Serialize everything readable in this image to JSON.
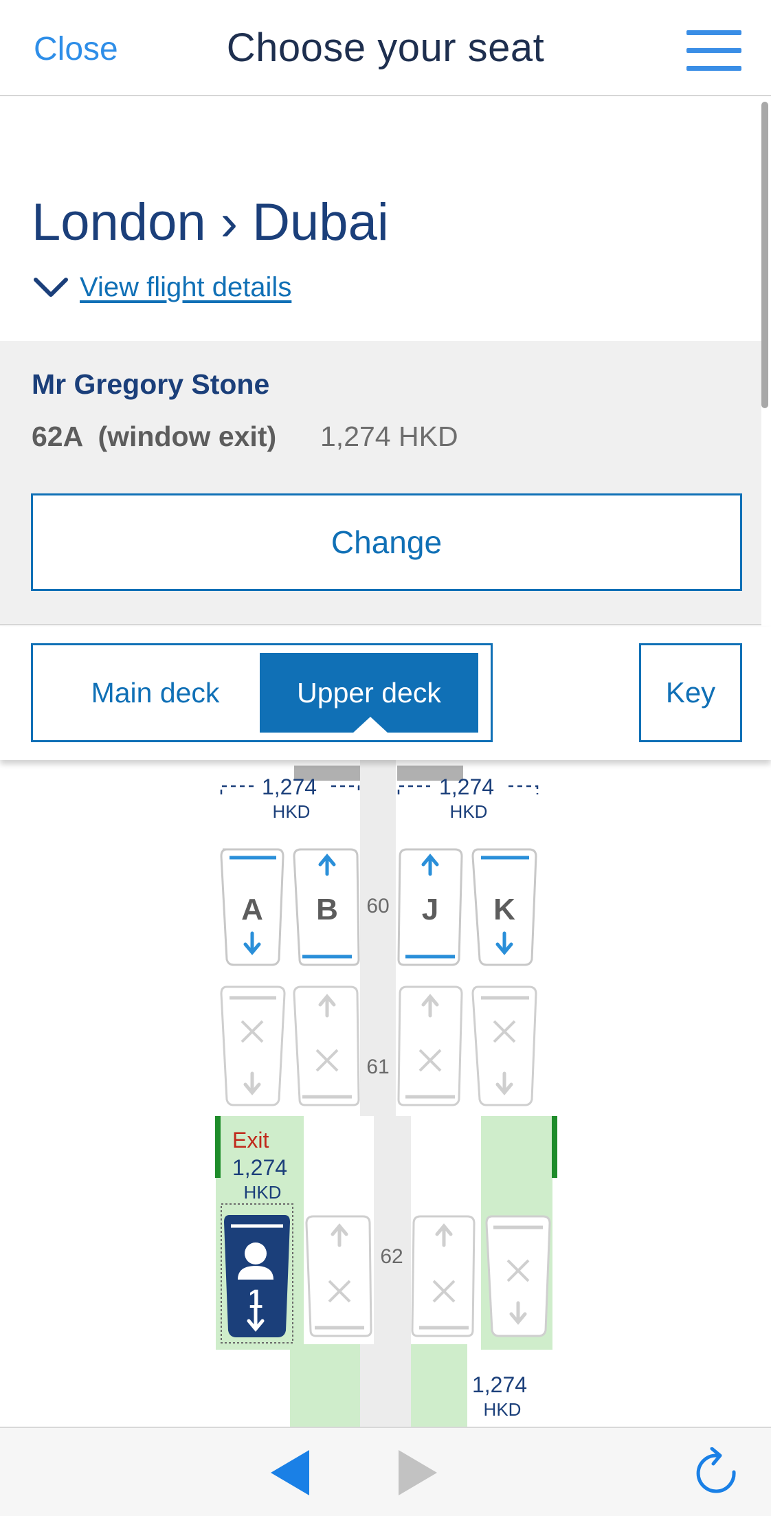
{
  "header": {
    "close_label": "Close",
    "title": "Choose your seat",
    "menu_icon": "hamburger-menu-icon"
  },
  "route": {
    "title": "London › Dubai",
    "details_link": "View flight details"
  },
  "passenger": {
    "name": "Mr Gregory Stone",
    "seat": "62A  (window exit)",
    "price": "1,274 HKD",
    "change_label": "Change"
  },
  "decks": {
    "main_label": "Main deck",
    "upper_label": "Upper deck",
    "selected": "Upper deck",
    "key_label": "Key"
  },
  "seatmap": {
    "price_left": {
      "amount": "1,274",
      "currency": "HKD"
    },
    "price_right": {
      "amount": "1,274",
      "currency": "HKD"
    },
    "exit_label": "Exit",
    "exit_price": {
      "amount": "1,274",
      "currency": "HKD"
    },
    "bottom_price": {
      "amount": "1,274",
      "currency": "HKD"
    },
    "rows": [
      {
        "number": "60",
        "seats": [
          {
            "letter": "A",
            "status": "available"
          },
          {
            "letter": "B",
            "status": "available"
          },
          {
            "letter": "J",
            "status": "available"
          },
          {
            "letter": "K",
            "status": "available"
          }
        ]
      },
      {
        "number": "61",
        "seats": [
          {
            "letter": "A",
            "status": "unavailable"
          },
          {
            "letter": "B",
            "status": "unavailable"
          },
          {
            "letter": "J",
            "status": "unavailable"
          },
          {
            "letter": "K",
            "status": "unavailable"
          }
        ]
      },
      {
        "number": "62",
        "seats": [
          {
            "letter": "A",
            "status": "selected",
            "passenger_number": "1"
          },
          {
            "letter": "B",
            "status": "unavailable"
          },
          {
            "letter": "J",
            "status": "unavailable"
          },
          {
            "letter": "K",
            "status": "unavailable"
          }
        ]
      }
    ],
    "colors": {
      "available": "#2a8fd9",
      "unavailable": "#c8c8c8",
      "selected": "#1b3f7a",
      "exit_zone": "#cfedcb",
      "exit_text": "#c0291b",
      "price_text": "#1b3f7a"
    }
  },
  "toolbar": {
    "back_icon": "back-arrow-icon",
    "forward_icon": "forward-arrow-icon",
    "reload_icon": "reload-icon"
  }
}
